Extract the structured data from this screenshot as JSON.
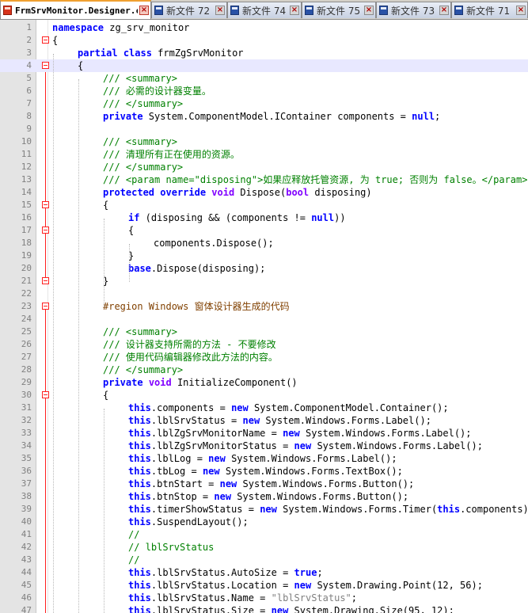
{
  "tabs": [
    {
      "label": "FrmSrvMonitor.Designer.cs",
      "active": true
    },
    {
      "label": "新文件 72",
      "active": false
    },
    {
      "label": "新文件 74",
      "active": false
    },
    {
      "label": "新文件 75",
      "active": false
    },
    {
      "label": "新文件 73",
      "active": false
    },
    {
      "label": "新文件 71",
      "active": false
    }
  ],
  "colors": {
    "keyword": "#0000ff",
    "comment": "#008000",
    "preprocessor": "#804000",
    "string": "#808080",
    "fold_marker": "#ff2020",
    "current_line": "#e8e8ff"
  },
  "editor": {
    "current_line": 4,
    "fold_lines": [
      2,
      4,
      15,
      17,
      21,
      23,
      30
    ],
    "lines": [
      {
        "n": 1,
        "indent": 0,
        "code": [
          {
            "t": "namespace",
            "c": "kw"
          },
          {
            "t": " zg_srv_monitor",
            "c": ""
          }
        ]
      },
      {
        "n": 2,
        "indent": 0,
        "code": [
          {
            "t": "{",
            "c": ""
          }
        ]
      },
      {
        "n": 3,
        "indent": 1,
        "code": [
          {
            "t": "partial",
            "c": "kw"
          },
          {
            "t": " ",
            "c": ""
          },
          {
            "t": "class",
            "c": "kw"
          },
          {
            "t": " frmZgSrvMonitor",
            "c": ""
          }
        ]
      },
      {
        "n": 4,
        "indent": 1,
        "code": [
          {
            "t": "{",
            "c": ""
          }
        ]
      },
      {
        "n": 5,
        "indent": 2,
        "code": [
          {
            "t": "/// <summary>",
            "c": "cm"
          }
        ]
      },
      {
        "n": 6,
        "indent": 2,
        "code": [
          {
            "t": "/// 必需的设计器变量。",
            "c": "cm"
          }
        ]
      },
      {
        "n": 7,
        "indent": 2,
        "code": [
          {
            "t": "/// </summary>",
            "c": "cm"
          }
        ]
      },
      {
        "n": 8,
        "indent": 2,
        "code": [
          {
            "t": "private",
            "c": "kw"
          },
          {
            "t": " System.ComponentModel.IContainer components = ",
            "c": ""
          },
          {
            "t": "null",
            "c": "kw"
          },
          {
            "t": ";",
            "c": ""
          }
        ]
      },
      {
        "n": 9,
        "indent": 0,
        "code": []
      },
      {
        "n": 10,
        "indent": 2,
        "code": [
          {
            "t": "/// <summary>",
            "c": "cm"
          }
        ]
      },
      {
        "n": 11,
        "indent": 2,
        "code": [
          {
            "t": "/// 清理所有正在使用的资源。",
            "c": "cm"
          }
        ]
      },
      {
        "n": 12,
        "indent": 2,
        "code": [
          {
            "t": "/// </summary>",
            "c": "cm"
          }
        ]
      },
      {
        "n": 13,
        "indent": 2,
        "code": [
          {
            "t": "/// <param name=\"disposing\">如果应释放托管资源, 为 true; 否则为 false。</param>",
            "c": "cm"
          }
        ]
      },
      {
        "n": 14,
        "indent": 2,
        "code": [
          {
            "t": "protected",
            "c": "kw"
          },
          {
            "t": " ",
            "c": ""
          },
          {
            "t": "override",
            "c": "kw"
          },
          {
            "t": " ",
            "c": ""
          },
          {
            "t": "void",
            "c": "kw2"
          },
          {
            "t": " Dispose(",
            "c": ""
          },
          {
            "t": "bool",
            "c": "kw2"
          },
          {
            "t": " disposing)",
            "c": ""
          }
        ]
      },
      {
        "n": 15,
        "indent": 2,
        "code": [
          {
            "t": "{",
            "c": ""
          }
        ]
      },
      {
        "n": 16,
        "indent": 3,
        "code": [
          {
            "t": "if",
            "c": "kw"
          },
          {
            "t": " (disposing && (components != ",
            "c": ""
          },
          {
            "t": "null",
            "c": "kw"
          },
          {
            "t": "))",
            "c": ""
          }
        ]
      },
      {
        "n": 17,
        "indent": 3,
        "code": [
          {
            "t": "{",
            "c": ""
          }
        ]
      },
      {
        "n": 18,
        "indent": 4,
        "code": [
          {
            "t": "components.Dispose();",
            "c": ""
          }
        ]
      },
      {
        "n": 19,
        "indent": 3,
        "code": [
          {
            "t": "}",
            "c": ""
          }
        ]
      },
      {
        "n": 20,
        "indent": 3,
        "code": [
          {
            "t": "base",
            "c": "kw"
          },
          {
            "t": ".Dispose(disposing);",
            "c": ""
          }
        ]
      },
      {
        "n": 21,
        "indent": 2,
        "code": [
          {
            "t": "}",
            "c": ""
          }
        ]
      },
      {
        "n": 22,
        "indent": 0,
        "code": []
      },
      {
        "n": 23,
        "indent": 2,
        "code": [
          {
            "t": "#region Windows 窗体设计器生成的代码",
            "c": "pp"
          }
        ]
      },
      {
        "n": 24,
        "indent": 0,
        "code": []
      },
      {
        "n": 25,
        "indent": 2,
        "code": [
          {
            "t": "/// <summary>",
            "c": "cm"
          }
        ]
      },
      {
        "n": 26,
        "indent": 2,
        "code": [
          {
            "t": "/// 设计器支持所需的方法 - 不要修改",
            "c": "cm"
          }
        ]
      },
      {
        "n": 27,
        "indent": 2,
        "code": [
          {
            "t": "/// 使用代码编辑器修改此方法的内容。",
            "c": "cm"
          }
        ]
      },
      {
        "n": 28,
        "indent": 2,
        "code": [
          {
            "t": "/// </summary>",
            "c": "cm"
          }
        ]
      },
      {
        "n": 29,
        "indent": 2,
        "code": [
          {
            "t": "private",
            "c": "kw"
          },
          {
            "t": " ",
            "c": ""
          },
          {
            "t": "void",
            "c": "kw2"
          },
          {
            "t": " InitializeComponent()",
            "c": ""
          }
        ]
      },
      {
        "n": 30,
        "indent": 2,
        "code": [
          {
            "t": "{",
            "c": ""
          }
        ]
      },
      {
        "n": 31,
        "indent": 3,
        "code": [
          {
            "t": "this",
            "c": "kw"
          },
          {
            "t": ".components = ",
            "c": ""
          },
          {
            "t": "new",
            "c": "kw"
          },
          {
            "t": " System.ComponentModel.Container();",
            "c": ""
          }
        ]
      },
      {
        "n": 32,
        "indent": 3,
        "code": [
          {
            "t": "this",
            "c": "kw"
          },
          {
            "t": ".lblSrvStatus = ",
            "c": ""
          },
          {
            "t": "new",
            "c": "kw"
          },
          {
            "t": " System.Windows.Forms.Label();",
            "c": ""
          }
        ]
      },
      {
        "n": 33,
        "indent": 3,
        "code": [
          {
            "t": "this",
            "c": "kw"
          },
          {
            "t": ".lblZgSrvMonitorName = ",
            "c": ""
          },
          {
            "t": "new",
            "c": "kw"
          },
          {
            "t": " System.Windows.Forms.Label();",
            "c": ""
          }
        ]
      },
      {
        "n": 34,
        "indent": 3,
        "code": [
          {
            "t": "this",
            "c": "kw"
          },
          {
            "t": ".lblZgSrvMonitorStatus = ",
            "c": ""
          },
          {
            "t": "new",
            "c": "kw"
          },
          {
            "t": " System.Windows.Forms.Label();",
            "c": ""
          }
        ]
      },
      {
        "n": 35,
        "indent": 3,
        "code": [
          {
            "t": "this",
            "c": "kw"
          },
          {
            "t": ".lblLog = ",
            "c": ""
          },
          {
            "t": "new",
            "c": "kw"
          },
          {
            "t": " System.Windows.Forms.Label();",
            "c": ""
          }
        ]
      },
      {
        "n": 36,
        "indent": 3,
        "code": [
          {
            "t": "this",
            "c": "kw"
          },
          {
            "t": ".tbLog = ",
            "c": ""
          },
          {
            "t": "new",
            "c": "kw"
          },
          {
            "t": " System.Windows.Forms.TextBox();",
            "c": ""
          }
        ]
      },
      {
        "n": 37,
        "indent": 3,
        "code": [
          {
            "t": "this",
            "c": "kw"
          },
          {
            "t": ".btnStart = ",
            "c": ""
          },
          {
            "t": "new",
            "c": "kw"
          },
          {
            "t": " System.Windows.Forms.Button();",
            "c": ""
          }
        ]
      },
      {
        "n": 38,
        "indent": 3,
        "code": [
          {
            "t": "this",
            "c": "kw"
          },
          {
            "t": ".btnStop = ",
            "c": ""
          },
          {
            "t": "new",
            "c": "kw"
          },
          {
            "t": " System.Windows.Forms.Button();",
            "c": ""
          }
        ]
      },
      {
        "n": 39,
        "indent": 3,
        "code": [
          {
            "t": "this",
            "c": "kw"
          },
          {
            "t": ".timerShowStatus = ",
            "c": ""
          },
          {
            "t": "new",
            "c": "kw"
          },
          {
            "t": " System.Windows.Forms.Timer(",
            "c": ""
          },
          {
            "t": "this",
            "c": "kw"
          },
          {
            "t": ".components);",
            "c": ""
          }
        ]
      },
      {
        "n": 40,
        "indent": 3,
        "code": [
          {
            "t": "this",
            "c": "kw"
          },
          {
            "t": ".SuspendLayout();",
            "c": ""
          }
        ]
      },
      {
        "n": 41,
        "indent": 3,
        "code": [
          {
            "t": "//",
            "c": "cm"
          }
        ]
      },
      {
        "n": 42,
        "indent": 3,
        "code": [
          {
            "t": "// lblSrvStatus",
            "c": "cm"
          }
        ]
      },
      {
        "n": 43,
        "indent": 3,
        "code": [
          {
            "t": "//",
            "c": "cm"
          }
        ]
      },
      {
        "n": 44,
        "indent": 3,
        "code": [
          {
            "t": "this",
            "c": "kw"
          },
          {
            "t": ".lblSrvStatus.AutoSize = ",
            "c": ""
          },
          {
            "t": "true",
            "c": "kw"
          },
          {
            "t": ";",
            "c": ""
          }
        ]
      },
      {
        "n": 45,
        "indent": 3,
        "code": [
          {
            "t": "this",
            "c": "kw"
          },
          {
            "t": ".lblSrvStatus.Location = ",
            "c": ""
          },
          {
            "t": "new",
            "c": "kw"
          },
          {
            "t": " System.Drawing.Point(12, 56);",
            "c": ""
          }
        ]
      },
      {
        "n": 46,
        "indent": 3,
        "code": [
          {
            "t": "this",
            "c": "kw"
          },
          {
            "t": ".lblSrvStatus.Name = ",
            "c": ""
          },
          {
            "t": "\"lblSrvStatus\"",
            "c": "str"
          },
          {
            "t": ";",
            "c": ""
          }
        ]
      },
      {
        "n": 47,
        "indent": 3,
        "code": [
          {
            "t": "this",
            "c": "kw"
          },
          {
            "t": ".lblSrvStatus.Size = ",
            "c": ""
          },
          {
            "t": "new",
            "c": "kw"
          },
          {
            "t": " System.Drawing.Size(95, 12);",
            "c": ""
          }
        ]
      }
    ]
  }
}
